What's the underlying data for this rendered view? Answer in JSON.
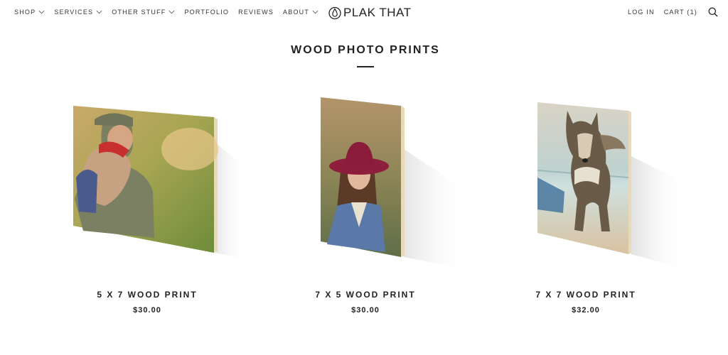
{
  "header": {
    "nav_left": [
      {
        "label": "SHOP",
        "dropdown": true
      },
      {
        "label": "SERVICES",
        "dropdown": true
      },
      {
        "label": "OTHER STUFF",
        "dropdown": true
      },
      {
        "label": "PORTFOLIO",
        "dropdown": false
      },
      {
        "label": "REVIEWS",
        "dropdown": false
      },
      {
        "label": "ABOUT",
        "dropdown": true
      }
    ],
    "logo_text": "PLAK THAT",
    "login_label": "LOG IN",
    "cart_label": "CART (1)",
    "search_icon": "search-icon"
  },
  "main": {
    "title": "WOOD PHOTO PRINTS",
    "products": [
      {
        "name": "5 X 7 WOOD PRINT",
        "price": "$30.00",
        "image": "soldier-hugging-child"
      },
      {
        "name": "7 X 5 WOOD PRINT",
        "price": "$30.00",
        "image": "girl-in-red-hat"
      },
      {
        "name": "7 X 7 WOOD PRINT",
        "price": "$32.00",
        "image": "dog-on-beach"
      }
    ]
  },
  "colors": {
    "text": "#222222",
    "background": "#ffffff",
    "wood_edge": "#e8d9b8"
  }
}
